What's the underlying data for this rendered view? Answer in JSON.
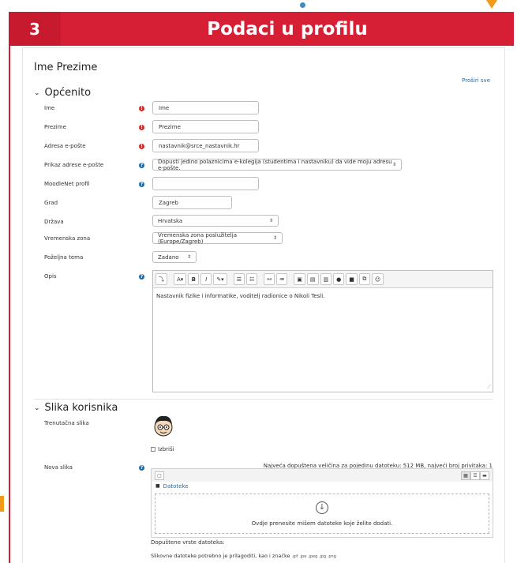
{
  "banner": {
    "number": "3",
    "title": "Podaci u profilu"
  },
  "profile": {
    "full_name": "Ime Prezime",
    "expand_all": "Proširi sve"
  },
  "general": {
    "heading": "Općenito",
    "fields": {
      "first_name": {
        "label": "Ime",
        "value": "Ime"
      },
      "last_name": {
        "label": "Prezime",
        "value": "Prezime"
      },
      "email": {
        "label": "Adresa e-pošte",
        "value": "nastavnik@srce_nastavnik.hr"
      },
      "email_display": {
        "label": "Prikaz adrese e-pošte",
        "value": "Dopusti jedino polaznicima e-kolegija (studentima i nastavniku) da vide moju adresu e-pošte."
      },
      "moodlenet": {
        "label": "MoodleNet profil",
        "value": ""
      },
      "city": {
        "label": "Grad",
        "value": "Zagreb"
      },
      "country": {
        "label": "Država",
        "value": "Hrvatska"
      },
      "timezone": {
        "label": "Vremenska zona",
        "value": "Vremenska zona poslužitelja (Europe/Zagreb)"
      },
      "theme": {
        "label": "Poželjna tema",
        "value": "Zadano"
      },
      "description": {
        "label": "Opis",
        "value": "Nastavnik fizike i informatike, voditelj radionice o Nikoli Tesli."
      }
    },
    "toolbar": {
      "expand": "⤵",
      "font": "A",
      "bold": "B",
      "italic": "I"
    }
  },
  "user_picture": {
    "heading": "Slika korisnika",
    "current_label": "Trenutačna slika",
    "delete_label": "Izbriši",
    "new_label": "Nova slika",
    "max_size": "Najveća dopuštena veličina za pojedinu datoteku: 512 MB, najveći broj privitaka: 1",
    "folder": "Datoteke",
    "drop_text": "Ovdje prenesite mišem datoteke koje želite dodati.",
    "file_types_title": "Dopuštene vrste datoteka:",
    "file_types_desc": "Slikovne datoteke potrebno je prilagoditi, kao i značke",
    "file_types_ext": ".gif .jpe .jpeg .jpg .png"
  },
  "colors": {
    "banner": "#d61f35",
    "link": "#1f6aa8",
    "required": "#c9302c",
    "accent_orange": "#f29a1a"
  }
}
